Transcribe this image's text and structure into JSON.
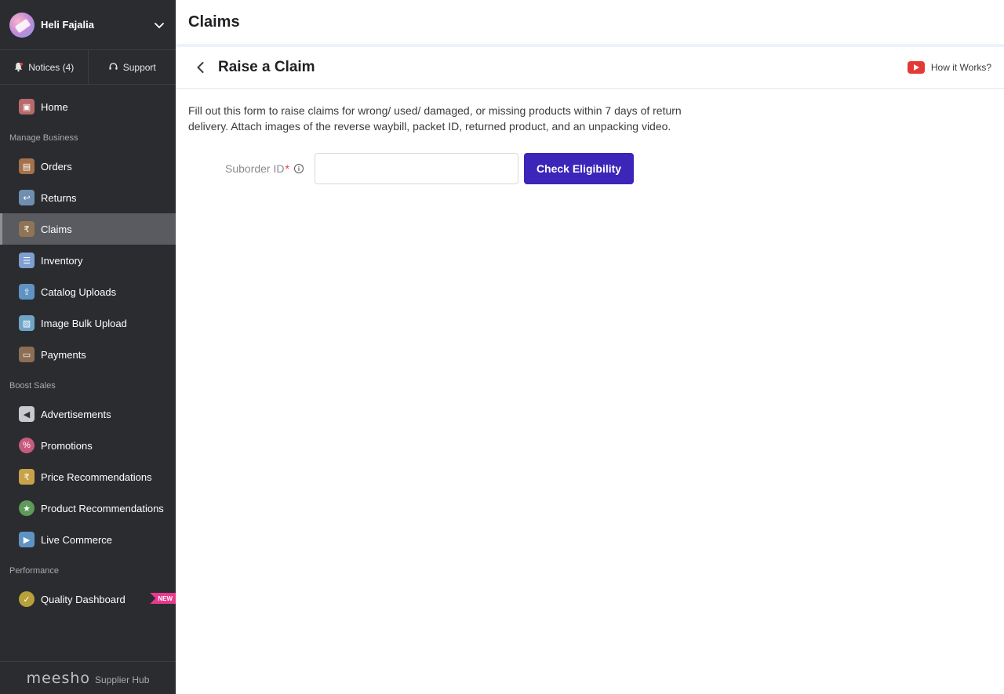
{
  "user": {
    "name": "Heli Fajalia"
  },
  "top_actions": {
    "notices_label": "Notices (4)",
    "support_label": "Support"
  },
  "sidebar": {
    "home": {
      "label": "Home",
      "icon": "home-icon"
    },
    "sections": {
      "manage_business": "Manage Business",
      "boost_sales": "Boost Sales",
      "performance": "Performance"
    },
    "manage_items": [
      {
        "label": "Orders",
        "icon": "orders-icon"
      },
      {
        "label": "Returns",
        "icon": "returns-icon"
      },
      {
        "label": "Claims",
        "icon": "claims-icon",
        "active": true
      },
      {
        "label": "Inventory",
        "icon": "inventory-icon"
      },
      {
        "label": "Catalog Uploads",
        "icon": "catalog-upload-icon"
      },
      {
        "label": "Image Bulk Upload",
        "icon": "image-upload-icon"
      },
      {
        "label": "Payments",
        "icon": "payments-icon"
      }
    ],
    "boost_items": [
      {
        "label": "Advertisements",
        "icon": "megaphone-icon"
      },
      {
        "label": "Promotions",
        "icon": "percent-icon"
      },
      {
        "label": "Price Recommendations",
        "icon": "price-tag-icon"
      },
      {
        "label": "Product Recommendations",
        "icon": "star-icon"
      },
      {
        "label": "Live Commerce",
        "icon": "video-icon"
      }
    ],
    "performance_items": [
      {
        "label": "Quality Dashboard",
        "icon": "quality-badge-icon",
        "badge": "NEW"
      }
    ],
    "footer": {
      "logo": "meesho",
      "sub": "Supplier Hub"
    }
  },
  "main": {
    "page_title": "Claims",
    "sub_title": "Raise a Claim",
    "how_it_works": "How it Works?",
    "description": "Fill out this form to raise  claims for wrong/ used/ damaged, or missing products within 7 days of return delivery. Attach images of the reverse waybill, packet ID, returned product, and an unpacking video.",
    "form": {
      "suborder_label": "Suborder ID",
      "required_mark": "*",
      "suborder_value": "",
      "suborder_placeholder": "",
      "check_button": "Check Eligibility"
    }
  },
  "colors": {
    "sidebar_bg": "#2b2c30",
    "active_item_bg": "#5a5b60",
    "primary_button": "#3b26b9",
    "new_badge": "#e83a8c",
    "youtube_red": "#e53935"
  }
}
